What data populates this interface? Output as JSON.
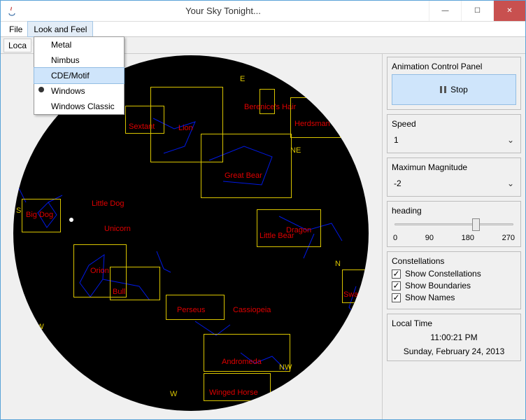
{
  "window": {
    "title": "Your Sky Tonight..."
  },
  "menubar": {
    "file": "File",
    "lookfeel": "Look and Feel"
  },
  "toolbar": {
    "local_button": "Loca"
  },
  "dropdown": {
    "metal": "Metal",
    "nimbus": "Nimbus",
    "cdemotif": "CDE/Motif",
    "windows": "Windows",
    "winclassic": "Windows Classic"
  },
  "compass": {
    "n": "N",
    "ne": "NE",
    "e": "E",
    "s": "S",
    "sw": "SW",
    "w": "W",
    "nw": "NW"
  },
  "constellations": {
    "sextant": "Sextant",
    "lion": "Lion",
    "berenice": "Berenice's Hair",
    "herdsman": "Herdsman",
    "big_dog": "Big Dog",
    "little_dog": "Little Dog",
    "unicorn": "Unicorn",
    "great_bear": "Great Bear",
    "dragon": "Dragon",
    "little_bear": "Little Bear",
    "orion": "Orion",
    "bull": "Bull",
    "swan": "Swan",
    "perseus": "Perseus",
    "cassiopeia": "Cassiopeia",
    "andromeda": "Andromeda",
    "winged_horse": "Winged Horse"
  },
  "panel": {
    "anim_title": "Animation Control Panel",
    "stop": "Stop",
    "speed_title": "Speed",
    "speed_value": "1",
    "mag_title": "Maximun Magnitude",
    "mag_value": "-2",
    "heading_title": "heading",
    "tick0": "0",
    "tick90": "90",
    "tick180": "180",
    "tick270": "270",
    "const_title": "Constellations",
    "show_const": "Show Constellations",
    "show_bound": "Show Boundaries",
    "show_names": "Show Names",
    "localtime_title": "Local Time",
    "time": "11:00:21 PM",
    "date": "Sunday, February 24, 2013"
  }
}
